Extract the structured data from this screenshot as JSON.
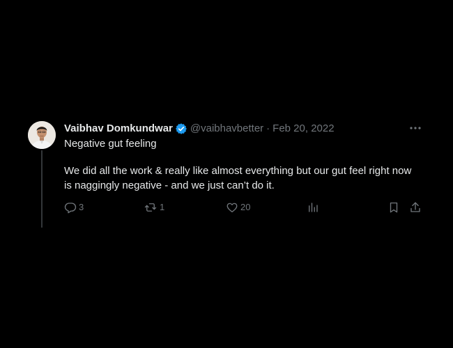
{
  "tweet": {
    "author": {
      "display_name": "Vaibhav Domkundwar",
      "handle": "@vaibhavbetter",
      "verified": true
    },
    "separator": "·",
    "date": "Feb 20, 2022",
    "text_lines": [
      "Negative gut feeling",
      "We did all the work & really like almost everything but our gut feel right now",
      "is naggingly negative - and we just can’t do it."
    ],
    "actions": {
      "replies": "3",
      "retweets": "1",
      "likes": "20"
    }
  },
  "colors": {
    "background": "#000000",
    "text": "#e7e9ea",
    "muted": "#71767b",
    "verified": "#1d9bf0",
    "thread_line": "#333639"
  },
  "icons": [
    "verified-icon",
    "more-icon",
    "reply-icon",
    "retweet-icon",
    "like-icon",
    "views-icon",
    "bookmark-icon",
    "share-icon"
  ]
}
